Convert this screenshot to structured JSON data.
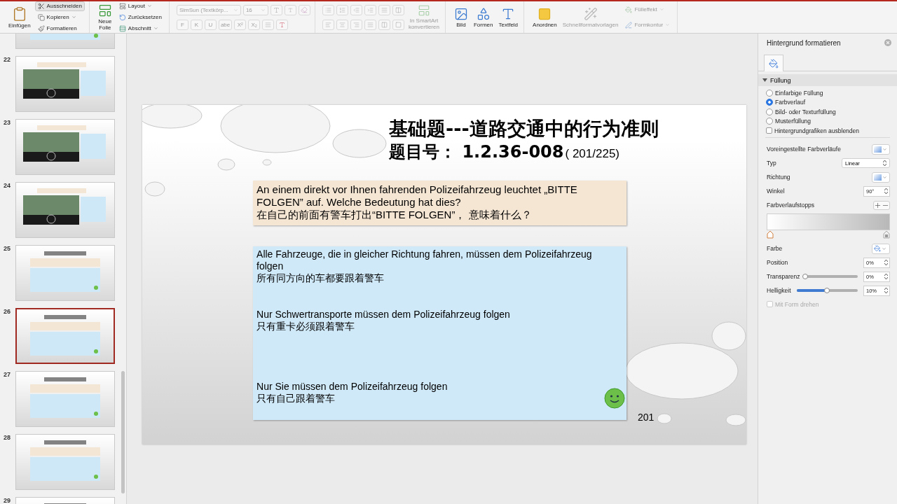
{
  "ribbon": {
    "clipboard": {
      "paste": "Einfügen",
      "cut": {
        "label": "Ausschneiden",
        "selected": true
      },
      "copy": "Kopieren",
      "format": "Formatieren"
    },
    "slides": {
      "new_slide": [
        "Neue",
        "Folie"
      ],
      "layout": "Layout",
      "reset": "Zurücksetzen",
      "section": "Abschnitt"
    },
    "font": {
      "disabled": true,
      "family": "SimSun (Textkörp...",
      "size": "16",
      "styles": [
        "F",
        "K",
        "U",
        "abe",
        "X²",
        "X₂"
      ]
    },
    "smartart": {
      "label": [
        "In SmartArt",
        "konvertieren"
      ],
      "disabled": true
    },
    "insert": [
      "Bild",
      "Formen",
      "Textfeld"
    ],
    "arrange": {
      "label": "Anordnen",
      "disabled": false
    },
    "quick_styles": {
      "label": "Schnellformatvorlagen",
      "disabled": true
    },
    "fill_effect": {
      "label": "Fülleffekt",
      "disabled": true
    },
    "shape_outline": {
      "label": "Formkontur",
      "disabled": true
    }
  },
  "thumbnails": [
    {
      "kind": "text",
      "selected": false
    },
    {
      "number": "22",
      "kind": "photo",
      "selected": false
    },
    {
      "number": "23",
      "kind": "photo",
      "selected": false
    },
    {
      "number": "24",
      "kind": "photo",
      "selected": false
    },
    {
      "number": "25",
      "kind": "text",
      "selected": false
    },
    {
      "number": "26",
      "kind": "text",
      "selected": true
    },
    {
      "number": "27",
      "kind": "text",
      "selected": false
    },
    {
      "number": "28",
      "kind": "text",
      "selected": false
    },
    {
      "number": "29",
      "kind": "text",
      "selected": false
    }
  ],
  "slide": {
    "title": "基础题---道路交通中的行为准则",
    "question_number": "题目号：  1.2.36-008",
    "question_count": "( 201/225)",
    "question": [
      "An einem direkt vor Ihnen fahrenden Polizeifahrzeug leuchtet „BITTE FOLGEN” auf. Welche Bedeutung hat dies?",
      "在自己的前面有警车打出“BITTE FOLGEN”， 意味着什么？"
    ],
    "answers": [
      {
        "de": "Alle Fahrzeuge, die in gleicher Richtung fahren, müssen dem Polizeifahrzeug folgen",
        "zh": "所有同方向的车都要跟着警车",
        "correct": false
      },
      {
        "de": "Nur Schwertransporte müssen dem Polizeifahrzeug folgen",
        "zh": "只有重卡必须跟着警车",
        "correct": false
      },
      {
        "de": "Nur Sie müssen dem Polizeifahrzeug folgen",
        "zh": "只有自己跟着警车",
        "correct": true
      }
    ],
    "page_number": "201"
  },
  "format_pane": {
    "title": "Hintergrund formatieren",
    "section": {
      "label": "Füllung",
      "expanded": true
    },
    "fill_options": [
      {
        "label": "Einfarbige Füllung",
        "selected": false
      },
      {
        "label": "Farbverlauf",
        "selected": true
      },
      {
        "label": "Bild- oder Texturfüllung",
        "selected": false
      },
      {
        "label": "Musterfüllung",
        "selected": false
      }
    ],
    "hide_graphics": {
      "label": "Hintergrundgrafiken ausblenden",
      "checked": false
    },
    "preset_label": "Voreingestellte Farbverläufe",
    "type_label": "Typ",
    "type_value": "Linear",
    "direction_label": "Richtung",
    "angle_label": "Winkel",
    "angle_value": "90°",
    "stops_label": "Farbverlaufstopps",
    "color_label": "Farbe",
    "position_label": "Position",
    "position_value": "0%",
    "transparency": {
      "label": "Transparenz",
      "level": 0,
      "value": "0%"
    },
    "brightness": {
      "label": "Helligkeit",
      "level": 0.5,
      "value": "10%"
    },
    "rotate": {
      "label": "Mit Form drehen",
      "checked": false,
      "disabled": true
    }
  }
}
